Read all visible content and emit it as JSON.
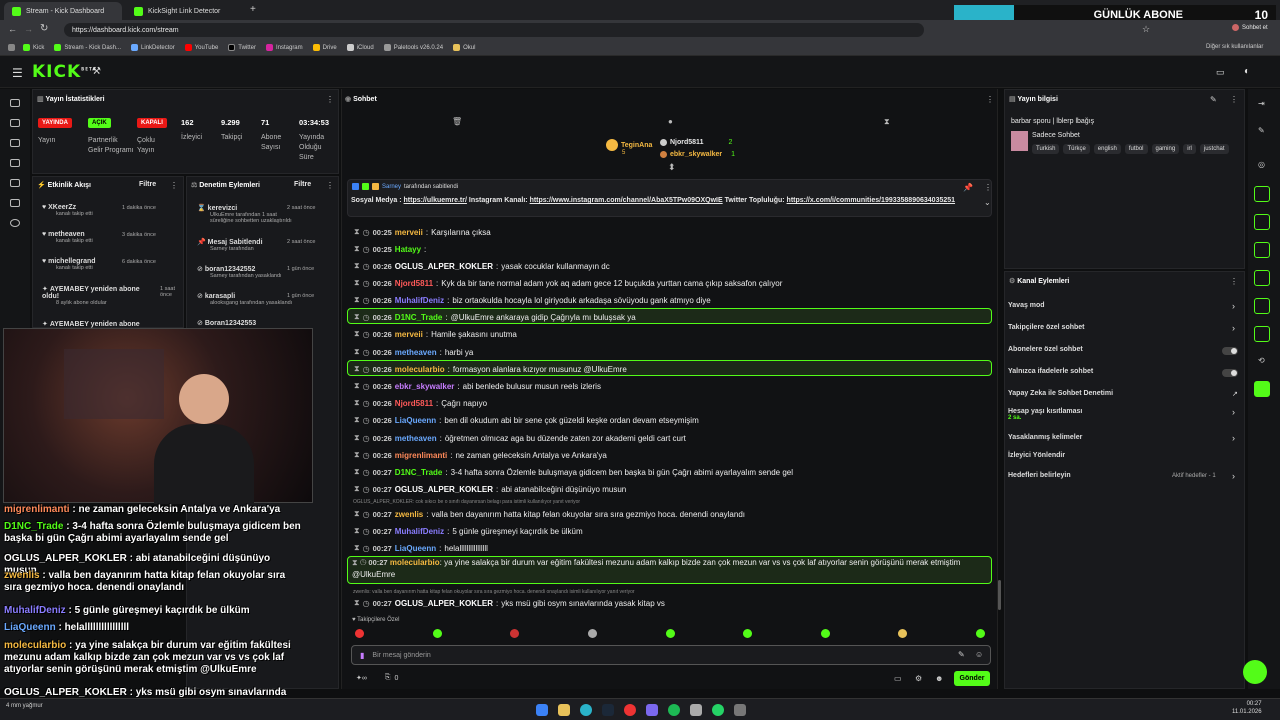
{
  "browser": {
    "tabs": [
      {
        "label": "Stream - Kick Dashboard"
      },
      {
        "label": "KickSight Link Detector"
      }
    ],
    "url": "https://dashboard.kick.com/stream",
    "profile_btn": "Sohbet et",
    "abone_label": "GÜNLÜK ABONE",
    "abone_count": "10",
    "bookmarks": [
      "Kick",
      "Stream - Kick Dash...",
      "LinkDetector",
      "YouTube",
      "Twitter",
      "Instagram",
      "Drive",
      "iCloud",
      "Paletools v26.0.24",
      "Okul"
    ],
    "other_bm": "Diğer sık kullanılanlar"
  },
  "header": {
    "logo": "KICK",
    "beta": "BETA"
  },
  "stats": {
    "title": "Yayın İstatistikleri",
    "badges": [
      {
        "text": "YAYINDA",
        "color": "#e91916"
      },
      {
        "text": "AÇIK",
        "color": "#53fc18"
      },
      {
        "text": "KAPALI",
        "color": "#e91916"
      }
    ],
    "labels": [
      "Yayın",
      "Partnerlik Gelir Programı",
      "Çoklu Yayın"
    ],
    "numbers": [
      {
        "v": "162",
        "l": "İzleyici"
      },
      {
        "v": "9.299",
        "l": "Takipçi"
      },
      {
        "v": "71",
        "l": "Abone Sayısı"
      },
      {
        "v": "03:34:53",
        "l": "Yayında Olduğu Süre"
      }
    ]
  },
  "activity": {
    "title": "Etkinlik Akışı",
    "filter": "Filtre",
    "items": [
      {
        "name": "XKeerZz",
        "sub": "kanalı takip etti",
        "time": "1 dakika önce"
      },
      {
        "name": "metheaven",
        "sub": "kanalı takip etti",
        "time": "3 dakika önce"
      },
      {
        "name": "michellegrand",
        "sub": "kanalı takip etti",
        "time": "6 dakika önce"
      },
      {
        "name": "AYEMABEY yeniden abone oldu!",
        "sub": "8 aylık abone oldular",
        "time": "1 saat önce"
      },
      {
        "name": "AYEMABEY yeniden abone",
        "sub": "",
        "time": "1 saat"
      }
    ]
  },
  "moderation": {
    "title": "Denetim Eylemleri",
    "filter": "Filtre",
    "items": [
      {
        "name": "kerevizci",
        "sub": "UlkuEmre tarafından 1 saat süreliğine sohbetten uzaklaştırıldı",
        "time": "2 saat önce"
      },
      {
        "name": "Mesaj Sabitlendi",
        "sub": "Sarney tarafından",
        "time": "2 saat önce"
      },
      {
        "name": "boran12342552",
        "sub": "Sarney tarafından yasaklandı",
        "time": "1 gün önce"
      },
      {
        "name": "karasapli",
        "sub": "alooksgang tarafından yasaklandı",
        "time": "1 gün önce"
      },
      {
        "name": "Boran12342553",
        "sub": "",
        "time": "1 gün önce"
      }
    ]
  },
  "chat": {
    "title": "Sohbet",
    "top_users": [
      {
        "name": "TeginAna",
        "n": "5"
      },
      {
        "name": "Njord5811",
        "n": "2"
      },
      {
        "name": "ebkr_skywalker",
        "n": "1"
      }
    ],
    "pinned": {
      "by": "Sarney",
      "by_suffix": "tarafından sabitlendi",
      "text1": "Sosyal Medya : ",
      "link1": "https://ulkuemre.tr/",
      "text2": " Instagram Kanalı: ",
      "link2": "https://www.instagram.com/channel/AbaX5TPw09OXQwIE",
      "text3": " Twitter Topluluğu:",
      "link3": "https://x.com/i/communities/1993358890634035251"
    },
    "messages": [
      {
        "t": "00:25",
        "u": "merveii",
        "c": "#f5b942",
        "m": "Karşılarına çıksa"
      },
      {
        "t": "00:25",
        "u": "Hatayy",
        "c": "#53fc18",
        "m": ""
      },
      {
        "t": "00:26",
        "u": "OGLUS_ALPER_KOKLER",
        "c": "#fff",
        "m": "yasak cocuklar kullanmayın dc"
      },
      {
        "t": "00:26",
        "u": "Njord5811",
        "c": "#ff5a5a",
        "m": "Kyk da bir tane normal adam yok aq adam gece 12 buçukda yurttan cama çıkıp saksafon çalıyor"
      },
      {
        "t": "00:26",
        "u": "MuhalifDeniz",
        "c": "#8a7dff",
        "m": "biz ortaokulda hocayla lol giriyoduk arkadaşa sövüyodu gank atmıyo diye"
      },
      {
        "t": "00:26",
        "u": "D1NC_Trade",
        "c": "#53fc18",
        "m": "@UlkuEmre ankaraya gidip Çağrıyla mı buluşsak ya"
      },
      {
        "t": "00:26",
        "u": "merveii",
        "c": "#f5b942",
        "m": "Hamile şakasını unutma"
      },
      {
        "t": "00:26",
        "u": "metheaven",
        "c": "#6aa9ff",
        "m": "harbi ya"
      },
      {
        "t": "00:26",
        "u": "molecularbio",
        "c": "#f5b942",
        "m": "formasyon alanlara kızıyor musunuz @UlkuEmre"
      },
      {
        "t": "00:26",
        "u": "ebkr_skywalker",
        "c": "#c77dff",
        "m": "abi benlede bulusur musun reels izleris"
      },
      {
        "t": "00:26",
        "u": "Njord5811",
        "c": "#ff5a5a",
        "m": "Çağrı napıyo"
      },
      {
        "t": "00:26",
        "u": "LiaQueenn",
        "c": "#6aa9ff",
        "m": "ben dil okudum abi bir sene çok güzeldi keşke ordan devam etseymişim"
      },
      {
        "t": "00:26",
        "u": "metheaven",
        "c": "#6aa9ff",
        "m": "öğretmen olmıcaz aga bu düzende zaten zor akademi geldi cart curt"
      },
      {
        "t": "00:26",
        "u": "migrenlimanti",
        "c": "#ff8a5a",
        "m": "ne zaman geleceksin Antalya ve Ankara'ya"
      },
      {
        "t": "00:27",
        "u": "D1NC_Trade",
        "c": "#53fc18",
        "m": "3-4 hafta sonra Özlemle buluşmaya gidicem ben başka bi gün Çağrı abimi ayarlayalım sende gel"
      },
      {
        "t": "00:27",
        "u": "OGLUS_ALPER_KOKLER",
        "c": "#fff",
        "m": "abi atanabilceğini düşünüyo musun"
      },
      {
        "t": "00:27",
        "u": "zwenlis",
        "c": "#f5b942",
        "m": "valla ben dayanırım hatta kitap felan okuyolar sıra sıra gezmiyo hoca. denendi onaylandı"
      },
      {
        "t": "00:27",
        "u": "MuhalifDeniz",
        "c": "#8a7dff",
        "m": "5 günle güreşmeyi kaçırdık be ülküm"
      },
      {
        "t": "00:27",
        "u": "LiaQueenn",
        "c": "#6aa9ff",
        "m": "helallllllllllllllll"
      },
      {
        "t": "00:27",
        "u": "molecularbio",
        "c": "#f5b942",
        "m": "ya yine salakça bir durum var eğitim fakültesi mezunu adam kalkıp bizde zan çok mezun var vs vs çok laf atıyorlar senin görüşünü merak etmiştim @UlkuEmre"
      },
      {
        "t": "00:27",
        "u": "OGLUS_ALPER_KOKLER",
        "c": "#fff",
        "m": "yks msü gibi osym sınavlarında yasak kitap vs"
      }
    ],
    "reply1": "OGLUS_ALPER_KOKLER: cok sıkıcı be o sınıfı dayanırsan belagı para istimli kullanılıyor yanıt veriyor",
    "reply2": "zwenlis: valla ben dayanırım hatta kitap felan okuyolar sıra sıra gezmiyo hoca. denendi onaylandı isimli kullanılıyor yanıt veriyor",
    "followers_only": "Takipçilere Özel",
    "input_placeholder": "Bir mesaj gönderin",
    "send": "Gönder",
    "points": "0"
  },
  "stream_info": {
    "title": "Yayın bilgisi",
    "stream_title": "barbar sporu | lblerp lbağış",
    "category": "Sadece Sohbet",
    "tags": [
      "Turkish",
      "Türkçe",
      "english",
      "futbol",
      "gaming",
      "irl",
      "justchat"
    ]
  },
  "channel_actions": {
    "title": "Kanal Eylemleri",
    "items": [
      {
        "label": "Yavaş mod",
        "kind": "chev"
      },
      {
        "label": "Takipçilere özel sohbet",
        "kind": "chev"
      },
      {
        "label": "Abonelere özel sohbet",
        "kind": "toggle"
      },
      {
        "label": "Yalnızca ifadelerle sohbet",
        "kind": "toggle"
      },
      {
        "label": "Yapay Zeka ile Sohbet Denetimi",
        "kind": "link"
      },
      {
        "label": "Hesap yaşı kısıtlaması",
        "kind": "chev",
        "sub": "2 sa."
      },
      {
        "label": "Yasaklanmış kelimeler",
        "kind": "chev"
      },
      {
        "label": "İzleyici Yönlendir",
        "kind": "none"
      },
      {
        "label": "Hedefleri belirleyin",
        "kind": "chev",
        "sub2": "Aktif hedefler - 1"
      }
    ]
  },
  "overlay": [
    {
      "u": "migrenlimanti",
      "c": "#ff8a5a",
      "m": "ne zaman geleceksin Antalya ve Ankara'ya"
    },
    {
      "u": "D1NC_Trade",
      "c": "#53fc18",
      "m": "3-4 hafta sonra Özlemle buluşmaya gidicem ben başka bi gün Çağrı abimi ayarlayalım sende gel"
    },
    {
      "u": "OGLUS_ALPER_KOKLER",
      "c": "#fff",
      "m": "abi atanabilceğini düşünüyo musun"
    },
    {
      "u": "zwenlis",
      "c": "#f5b942",
      "m": "valla ben dayanırım hatta kitap felan okuyolar sıra sıra gezmiyo hoca. denendi onaylandı"
    },
    {
      "u": "MuhalifDeniz",
      "c": "#8a7dff",
      "m": "5 günle güreşmeyi kaçırdık be ülküm"
    },
    {
      "u": "LiaQueenn",
      "c": "#6aa9ff",
      "m": "helallllllllllllllll"
    },
    {
      "u": "molecularbio",
      "c": "#f5b942",
      "m": "ya yine salakça bir durum var eğitim fakültesi mezunu adam kalkıp bizde zan çok mezun var vs vs çok laf atıyorlar senin görüşünü merak etmiştim @UlkuEmre"
    },
    {
      "u": "OGLUS_ALPER_KOKLER",
      "c": "#fff",
      "m": "yks msü gibi osym sınavlarında yasak kitap vs"
    }
  ],
  "taskbar": {
    "time": "00:27",
    "date": "11.01.2026",
    "weather": "4 mm yağmur"
  }
}
